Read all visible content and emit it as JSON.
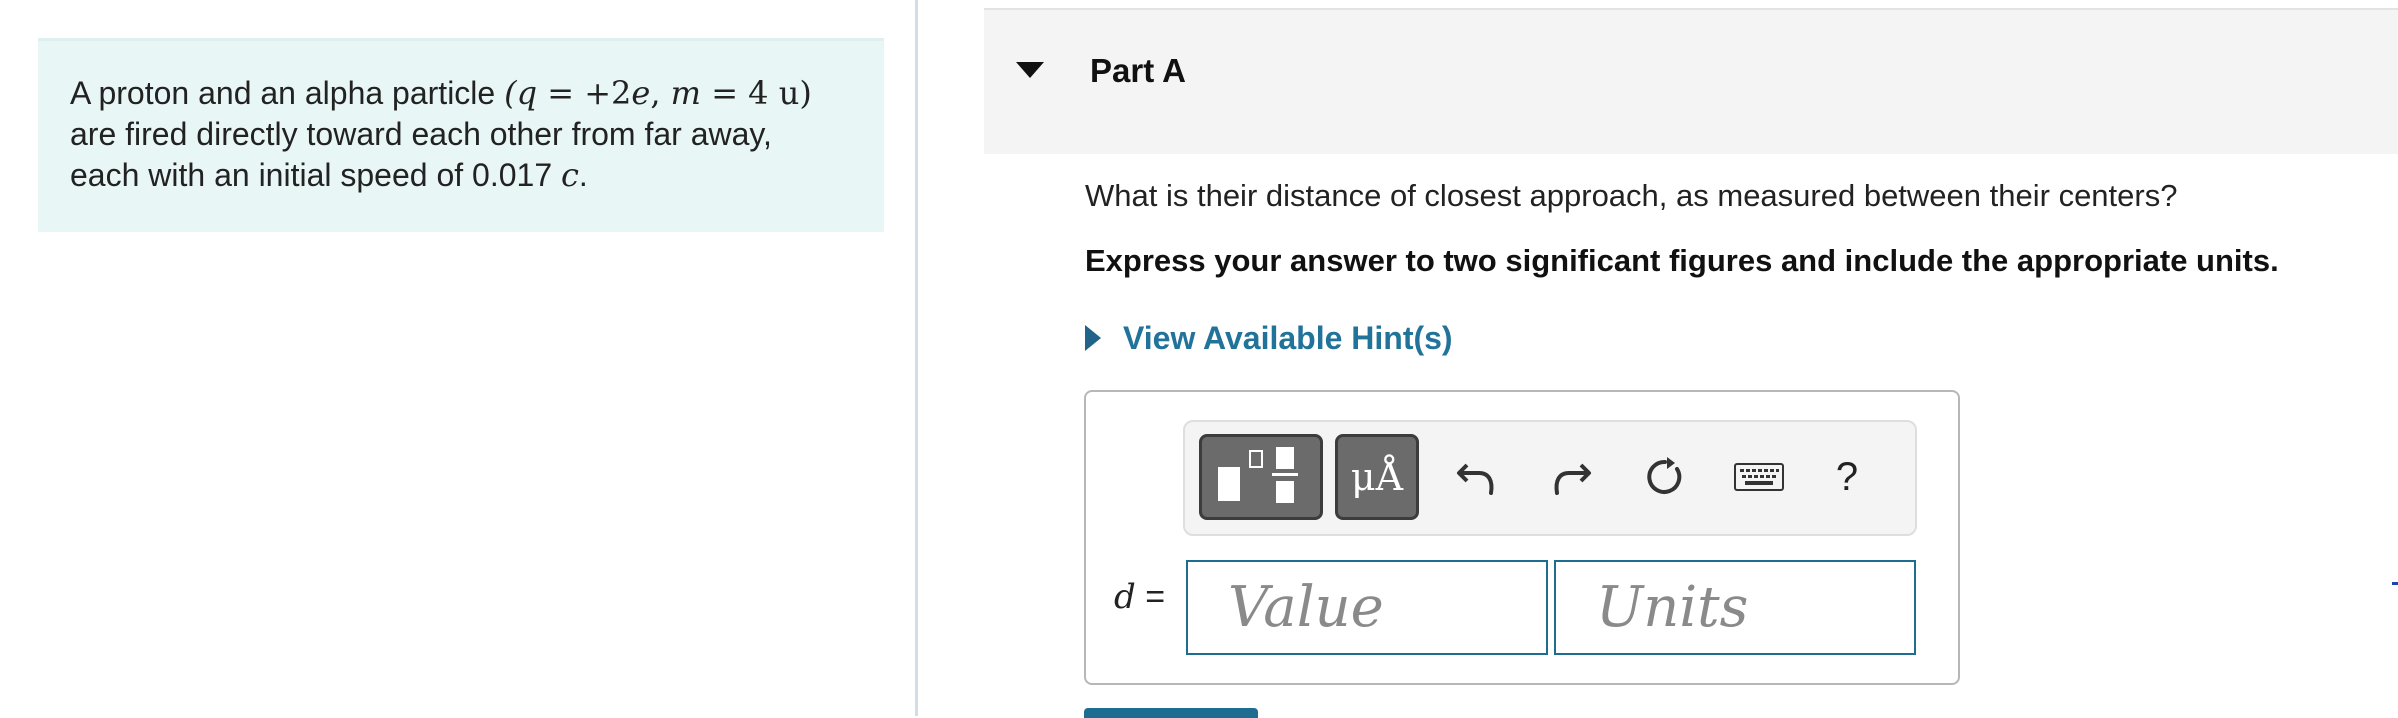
{
  "problem": {
    "text_before": "A proton and an alpha particle ",
    "math_q": "(q",
    "eq1": " = +2",
    "math_e": "e",
    "comma": ", ",
    "math_m": "m",
    "eq2": " = 4 u)",
    "line2": "are fired directly toward each other from far away,",
    "line3_before": "each with an initial speed of 0.017 ",
    "math_c": "c",
    "line3_after": "."
  },
  "part": {
    "title": "Part A",
    "question": "What is their distance of closest approach, as measured between their centers?",
    "instruction": "Express your answer to two significant figures and include the appropriate units.",
    "hint_label": "View Available Hint(s)"
  },
  "toolbar": {
    "units_symbol": "μÅ",
    "help_symbol": "?",
    "icons": [
      "templates-icon",
      "units-icon",
      "undo-icon",
      "redo-icon",
      "reset-icon",
      "keyboard-icon",
      "help-icon"
    ]
  },
  "answer": {
    "variable": "d",
    "equals": " =",
    "value_placeholder": "Value",
    "units_placeholder": "Units"
  },
  "colors": {
    "intro_bg": "#e8f6f6",
    "accent": "#21739a",
    "input_border": "#1f6d8e",
    "toolbar_button": "#6b6b6b"
  }
}
